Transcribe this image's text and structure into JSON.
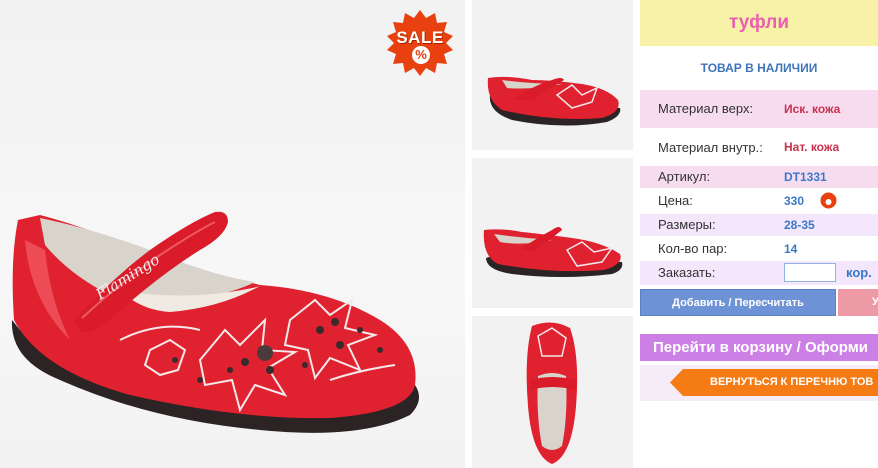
{
  "product": {
    "title": "туфли",
    "stock_status": "ТОВАР В НАЛИЧИИ",
    "sale_badge": "SALE",
    "sale_percent": "%",
    "brand_on_shoe": "Flamingo"
  },
  "specs": {
    "upper": {
      "label": "Материал верх:",
      "value": "Иск. кожа"
    },
    "lining": {
      "label": "Материал внутр.:",
      "value": "Нат. кожа"
    },
    "article": {
      "label": "Артикул:",
      "value": "DT1331"
    },
    "price": {
      "label": "Цена:",
      "value": "330"
    },
    "sizes": {
      "label": "Размеры:",
      "value": "28-35"
    },
    "pairs": {
      "label": "Кол-во пар:",
      "value": "14"
    },
    "order": {
      "label": "Заказать:",
      "value": "",
      "unit": "кор."
    }
  },
  "buttons": {
    "add": "Добавить / Пересчитать",
    "remove": "У",
    "cart": "Перейти в корзину / Оформи",
    "back": "ВЕРНУТЬСЯ К ПЕРЕЧНЮ ТОВ"
  },
  "colors": {
    "shoe_red": "#e0212f",
    "title_bg": "#f8f1a8",
    "title_text": "#ea5fae",
    "stock_text": "#3f74b8",
    "cart_bg": "#cc80e6",
    "back_bg": "#f57b14",
    "add_bg": "#6d93d6"
  }
}
